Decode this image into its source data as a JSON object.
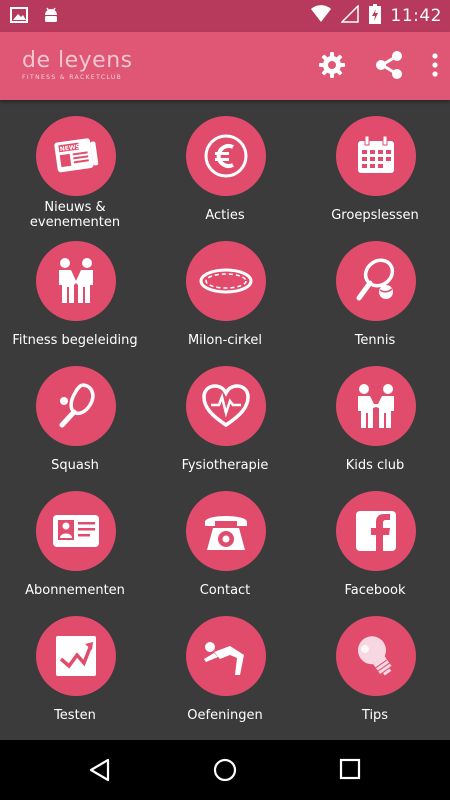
{
  "status_bar": {
    "time": "11:42"
  },
  "app_bar": {
    "brand_name": "de leyens",
    "brand_tagline": "FITNESS & RACKETCLUB"
  },
  "tiles": [
    {
      "label": "Nieuws & evenementen",
      "icon": "newspaper-icon"
    },
    {
      "label": "Acties",
      "icon": "euro-icon"
    },
    {
      "label": "Groepslessen",
      "icon": "calendar-icon"
    },
    {
      "label": "Fitness begeleiding",
      "icon": "trainer-people-icon"
    },
    {
      "label": "Milon-cirkel",
      "icon": "ring-icon"
    },
    {
      "label": "Tennis",
      "icon": "tennis-icon"
    },
    {
      "label": "Squash",
      "icon": "squash-icon"
    },
    {
      "label": "Fysiotherapie",
      "icon": "heartbeat-icon"
    },
    {
      "label": "Kids club",
      "icon": "kids-icon"
    },
    {
      "label": "Abonnementen",
      "icon": "membership-card-icon"
    },
    {
      "label": "Contact",
      "icon": "telephone-icon"
    },
    {
      "label": "Facebook",
      "icon": "facebook-icon"
    },
    {
      "label": "Testen",
      "icon": "chart-arrow-icon"
    },
    {
      "label": "Oefeningen",
      "icon": "exercise-icon"
    },
    {
      "label": "Tips",
      "icon": "lightbulb-icon"
    }
  ],
  "colors": {
    "status_bar": "#b73a5c",
    "app_bar": "#e05775",
    "tile_circle": "#e14c6d",
    "background": "#3b3b3b"
  }
}
